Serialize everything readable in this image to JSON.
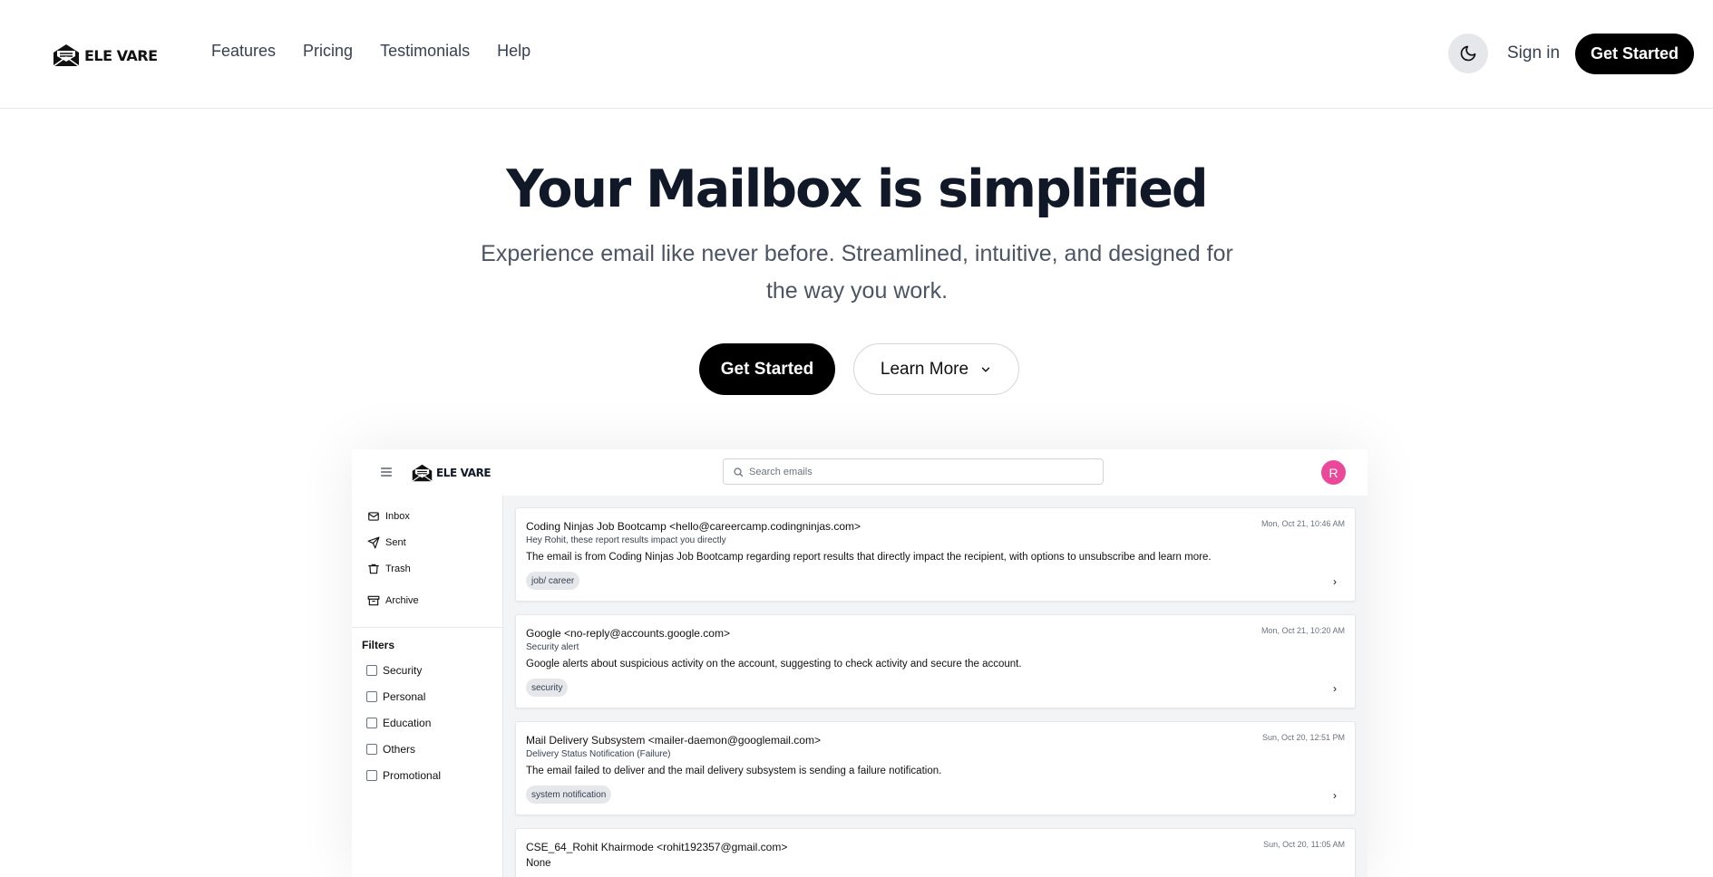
{
  "nav": {
    "logo_text": "ELE VARE",
    "links": [
      "Features",
      "Pricing",
      "Testimonials",
      "Help"
    ],
    "theme_icon": "moon-icon",
    "signin_label": "Sign in",
    "cta_label": "Get Started"
  },
  "hero": {
    "title": "Your Mailbox is simplified",
    "subtitle": "Experience email like never before. Streamlined, intuitive, and designed for the way you work.",
    "primary_label": "Get Started",
    "secondary_label": "Learn More"
  },
  "preview": {
    "logo_text": "ELE VARE",
    "search_placeholder": "Search emails",
    "avatar_initial": "R",
    "avatar_color": "#ec4899",
    "sidebar": [
      {
        "label": "Inbox",
        "icon": "inbox-icon"
      },
      {
        "label": "Sent",
        "icon": "send-icon"
      },
      {
        "label": "Trash",
        "icon": "trash-icon"
      },
      {
        "label": "Archive",
        "icon": "archive-icon"
      }
    ],
    "filters_title": "Filters",
    "filters": [
      "Security",
      "Personal",
      "Education",
      "Others",
      "Promotional"
    ],
    "emails": [
      {
        "from": "Coding Ninjas Job Bootcamp <hello@careercamp.codingninjas.com>",
        "date": "Mon, Oct 21, 10:46 AM",
        "subject": "Hey Rohit, these report results impact you directly",
        "summary": "The email is from Coding Ninjas Job Bootcamp regarding report results that directly impact the recipient, with options to unsubscribe and learn more.",
        "tag": "job/ career"
      },
      {
        "from": "Google <no-reply@accounts.google.com>",
        "date": "Mon, Oct 21, 10:20 AM",
        "subject": "Security alert",
        "summary": "Google alerts about suspicious activity on the account, suggesting to check activity and secure the account.",
        "tag": "security"
      },
      {
        "from": "Mail Delivery Subsystem <mailer-daemon@googlemail.com>",
        "date": "Sun, Oct 20, 12:51 PM",
        "subject": "Delivery Status Notification (Failure)",
        "summary": "The email failed to deliver and the mail delivery subsystem is sending a failure notification.",
        "tag": "system notification"
      },
      {
        "from": "CSE_64_Rohit Khairmode <rohit192357@gmail.com>",
        "date": "Sun, Oct 20, 11:05 AM",
        "subject": "",
        "summary": "None",
        "tag": ""
      }
    ]
  }
}
